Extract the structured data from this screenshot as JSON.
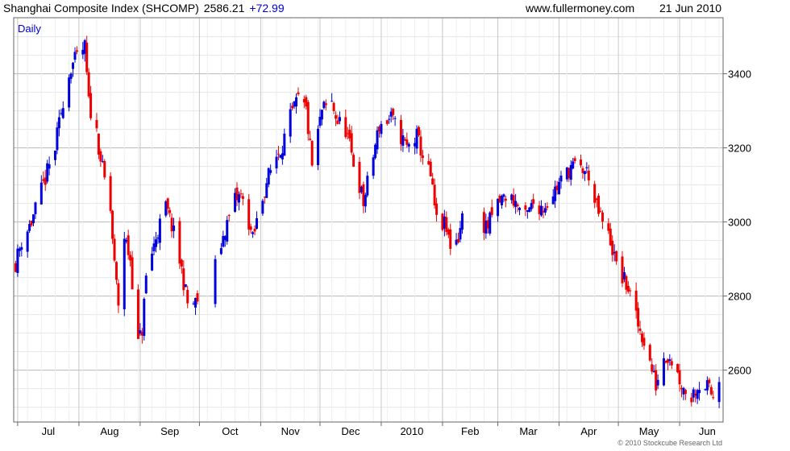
{
  "header": {
    "title": "Shanghai Composite Index (SHCOMP)",
    "price": "2586.21",
    "change": "+72.99",
    "website": "www.fullermoney.com",
    "date": "21 Jun 2010"
  },
  "footer": {
    "copyright": "© 2010 Stockcube Research Ltd"
  },
  "colors": {
    "up": "#0000dd",
    "down": "#ee0000",
    "grid": "#cccccc",
    "frame": "#666666",
    "label_blue": "#0000cc"
  },
  "chart_data": {
    "type": "candlestick",
    "period_label": "Daily",
    "x_tick_labels": [
      "Jul",
      "Aug",
      "Sep",
      "Oct",
      "Nov",
      "Dec",
      "2010",
      "Feb",
      "Mar",
      "Apr",
      "May",
      "Jun"
    ],
    "y_tick_labels": [
      "2600",
      "2800",
      "3000",
      "3200",
      "3400"
    ],
    "ylim": [
      2460,
      3510
    ],
    "grid": true,
    "close_path": [
      [
        "2009-06-30",
        2890
      ],
      [
        "2009-07-03",
        2950
      ],
      [
        "2009-07-08",
        3000
      ],
      [
        "2009-07-14",
        3100
      ],
      [
        "2009-07-20",
        3200
      ],
      [
        "2009-07-24",
        3330
      ],
      [
        "2009-07-28",
        3420
      ],
      [
        "2009-08-04",
        3470
      ],
      [
        "2009-08-06",
        3320
      ],
      [
        "2009-08-10",
        3240
      ],
      [
        "2009-08-13",
        3140
      ],
      [
        "2009-08-17",
        3030
      ],
      [
        "2009-08-19",
        2880
      ],
      [
        "2009-08-21",
        2780
      ],
      [
        "2009-08-24",
        2960
      ],
      [
        "2009-08-27",
        2900
      ],
      [
        "2009-08-31",
        2670
      ],
      [
        "2009-09-02",
        2710
      ],
      [
        "2009-09-04",
        2850
      ],
      [
        "2009-09-09",
        2960
      ],
      [
        "2009-09-14",
        3040
      ],
      [
        "2009-09-17",
        2990
      ],
      [
        "2009-09-22",
        2870
      ],
      [
        "2009-09-25",
        2780
      ],
      [
        "2009-09-29",
        2780
      ],
      [
        "2009-10-09",
        2880
      ],
      [
        "2009-10-14",
        2980
      ],
      [
        "2009-10-19",
        3060
      ],
      [
        "2009-10-22",
        3070
      ],
      [
        "2009-10-26",
        3000
      ],
      [
        "2009-10-28",
        2950
      ],
      [
        "2009-10-30",
        3000
      ],
      [
        "2009-11-04",
        3110
      ],
      [
        "2009-11-09",
        3180
      ],
      [
        "2009-11-12",
        3210
      ],
      [
        "2009-11-16",
        3280
      ],
      [
        "2009-11-20",
        3330
      ],
      [
        "2009-11-24",
        3300
      ],
      [
        "2009-11-27",
        3150
      ],
      [
        "2009-12-02",
        3300
      ],
      [
        "2009-12-07",
        3320
      ],
      [
        "2009-12-10",
        3270
      ],
      [
        "2009-12-14",
        3250
      ],
      [
        "2009-12-17",
        3180
      ],
      [
        "2009-12-21",
        3100
      ],
      [
        "2009-12-23",
        3050
      ],
      [
        "2009-12-28",
        3180
      ],
      [
        "2009-12-31",
        3260
      ],
      [
        "2010-01-06",
        3280
      ],
      [
        "2010-01-11",
        3230
      ],
      [
        "2010-01-14",
        3200
      ],
      [
        "2010-01-19",
        3230
      ],
      [
        "2010-01-22",
        3180
      ],
      [
        "2010-01-26",
        3120
      ],
      [
        "2010-01-29",
        3000
      ],
      [
        "2010-02-02",
        2990
      ],
      [
        "2010-02-05",
        2940
      ],
      [
        "2010-02-09",
        2960
      ],
      [
        "2010-02-11",
        3010
      ],
      [
        "2010-02-24",
        2990
      ],
      [
        "2010-03-01",
        3050
      ],
      [
        "2010-03-05",
        3070
      ],
      [
        "2010-03-09",
        3060
      ],
      [
        "2010-03-15",
        3010
      ],
      [
        "2010-03-19",
        3050
      ],
      [
        "2010-03-24",
        3040
      ],
      [
        "2010-03-29",
        3080
      ],
      [
        "2010-04-02",
        3110
      ],
      [
        "2010-04-07",
        3150
      ],
      [
        "2010-04-13",
        3140
      ],
      [
        "2010-04-16",
        3130
      ],
      [
        "2010-04-19",
        3050
      ],
      [
        "2010-04-22",
        3010
      ],
      [
        "2010-04-27",
        2950
      ],
      [
        "2010-04-30",
        2880
      ],
      [
        "2010-05-06",
        2820
      ],
      [
        "2010-05-11",
        2720
      ],
      [
        "2010-05-14",
        2680
      ],
      [
        "2010-05-18",
        2600
      ],
      [
        "2010-05-20",
        2560
      ],
      [
        "2010-05-24",
        2640
      ],
      [
        "2010-05-27",
        2640
      ],
      [
        "2010-05-31",
        2590
      ],
      [
        "2010-06-03",
        2550
      ],
      [
        "2010-06-07",
        2530
      ],
      [
        "2010-06-10",
        2560
      ],
      [
        "2010-06-14",
        2560
      ],
      [
        "2010-06-18",
        2530
      ],
      [
        "2010-06-21",
        2586
      ]
    ]
  }
}
